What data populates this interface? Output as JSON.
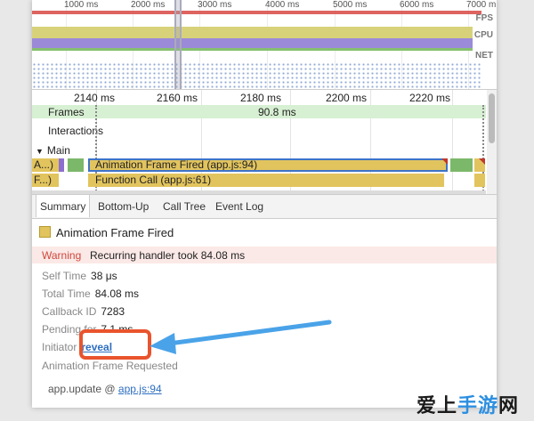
{
  "overview": {
    "ticks": [
      "1000 ms",
      "2000 ms",
      "3000 ms",
      "4000 ms",
      "5000 ms",
      "6000 ms",
      "7000 m"
    ],
    "lanes": {
      "fps": "FPS",
      "cpu": "CPU",
      "net": "NET"
    }
  },
  "flame": {
    "ticks": [
      "2140 ms",
      "2160 ms",
      "2180 ms",
      "2200 ms",
      "2220 ms"
    ],
    "frames_label": "Frames",
    "frames_value": "90.8 ms",
    "interactions_label": "Interactions",
    "main_label": "Main",
    "events": {
      "row1_left": "A...)",
      "row1_main": "Animation Frame Fired (app.js:94)",
      "row2_left": "F...)",
      "row2_main": "Function Call (app.js:61)"
    }
  },
  "tabs": [
    "Summary",
    "Bottom-Up",
    "Call Tree",
    "Event Log"
  ],
  "details": {
    "title": "Animation Frame Fired",
    "warning_key": "Warning",
    "warning_value": "Recurring handler took 84.08 ms",
    "self_time_key": "Self Time",
    "self_time_value": "38 μs",
    "total_time_key": "Total Time",
    "total_time_value": "84.08 ms",
    "callback_id_key": "Callback ID",
    "callback_id_value": "7283",
    "pending_key": "Pending for",
    "pending_value": "7.1 ms",
    "initiator_key": "Initiator",
    "initiator_link": "reveal",
    "requested_label": "Animation Frame Requested",
    "stack_fn": "app.update @",
    "stack_link": "app.js:94"
  },
  "watermark": {
    "part1": "爱上",
    "part2": "手游",
    "part3": "网"
  },
  "colors": {
    "accent_blue": "#3d73c9",
    "callout_orange": "#e9542d",
    "arrow_blue": "#4aa3e8",
    "event_yellow": "#e2c45e",
    "warning_red": "#d0473b"
  }
}
